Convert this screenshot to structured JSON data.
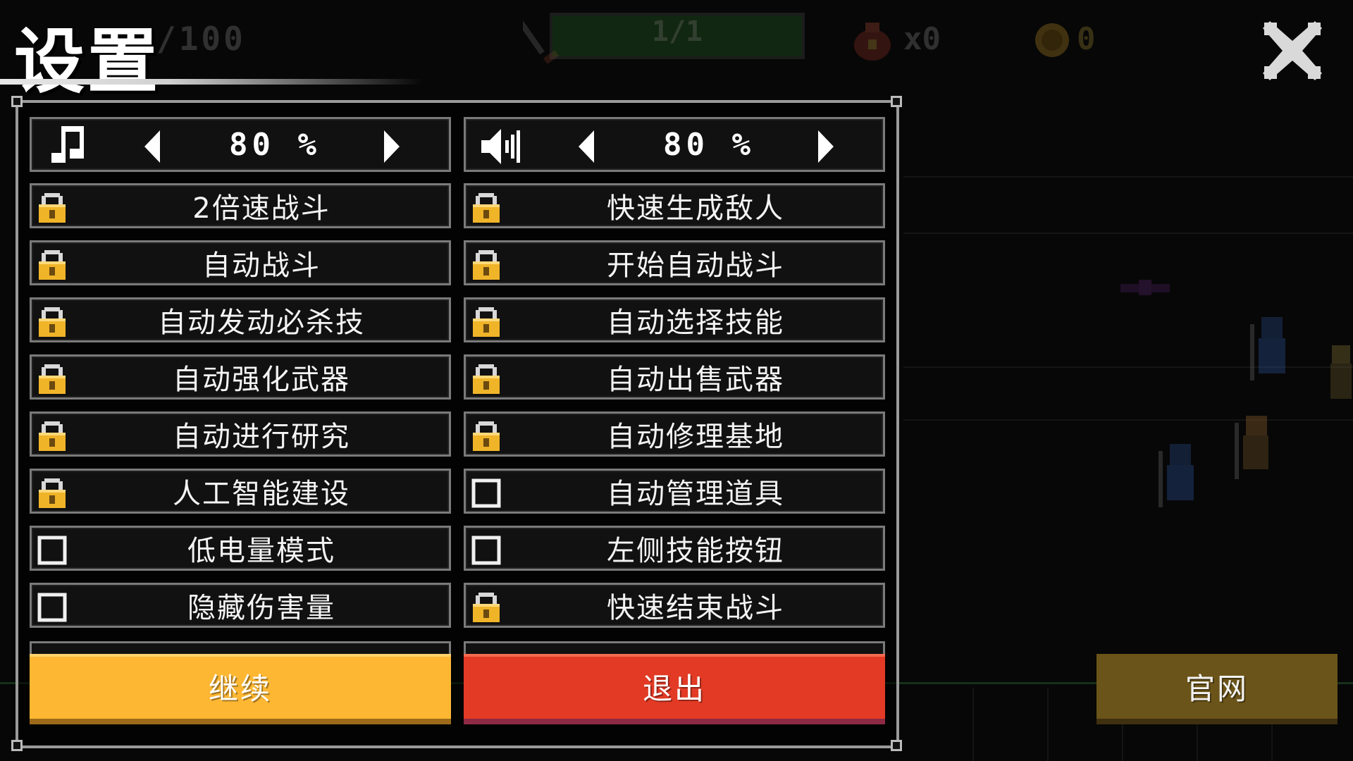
{
  "title": "设置",
  "hud": {
    "kills": "/100",
    "wave": "1/1",
    "bag_count": "x0",
    "coins": "0"
  },
  "volume": {
    "music": {
      "icon": "music-note-icon",
      "value": "80 %"
    },
    "sound": {
      "icon": "speaker-icon",
      "value": "80 %"
    }
  },
  "options_left": [
    {
      "label": "2倍速战斗",
      "state": "locked"
    },
    {
      "label": "自动战斗",
      "state": "locked"
    },
    {
      "label": "自动发动必杀技",
      "state": "locked"
    },
    {
      "label": "自动强化武器",
      "state": "locked"
    },
    {
      "label": "自动进行研究",
      "state": "locked"
    },
    {
      "label": "人工智能建设",
      "state": "locked"
    },
    {
      "label": "低电量模式",
      "state": "unchecked"
    },
    {
      "label": "隐藏伤害量",
      "state": "unchecked"
    }
  ],
  "options_right": [
    {
      "label": "快速生成敌人",
      "state": "locked"
    },
    {
      "label": "开始自动战斗",
      "state": "locked"
    },
    {
      "label": "自动选择技能",
      "state": "locked"
    },
    {
      "label": "自动出售武器",
      "state": "locked"
    },
    {
      "label": "自动修理基地",
      "state": "locked"
    },
    {
      "label": "自动管理道具",
      "state": "unchecked"
    },
    {
      "label": "左侧技能按钮",
      "state": "unchecked"
    },
    {
      "label": "快速结束战斗",
      "state": "locked"
    }
  ],
  "buttons": {
    "continue": "继续",
    "exit": "退出",
    "website": "官网"
  },
  "colors": {
    "continue": "#fdb733",
    "exit": "#e23a25",
    "website": "#6b5419",
    "lock_gold": "#f0b429"
  }
}
